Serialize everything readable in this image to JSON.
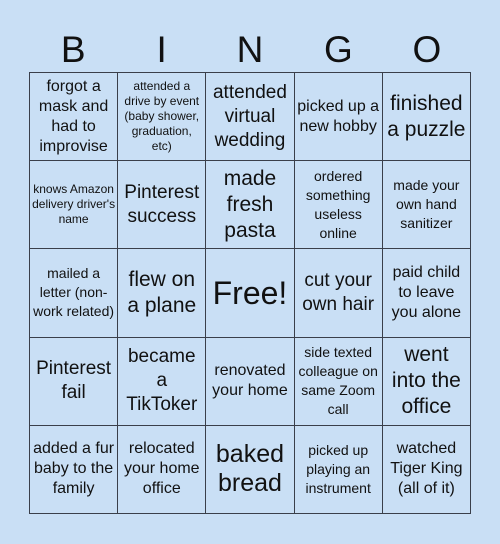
{
  "header": {
    "letters": [
      "B",
      "I",
      "N",
      "G",
      "O"
    ]
  },
  "board": {
    "rows": [
      [
        "forgot a mask and had to improvise",
        "attended a drive by event (baby shower, graduation, etc)",
        "attended virtual wedding",
        "picked up a new hobby",
        "finished a puzzle"
      ],
      [
        "knows Amazon delivery driver's name",
        "Pinterest success",
        "made fresh pasta",
        "ordered something useless online",
        "made your own hand sanitizer"
      ],
      [
        "mailed a letter (non-work related)",
        "flew on a plane",
        "Free!",
        "cut your own hair",
        "paid child to leave you alone"
      ],
      [
        "Pinterest fail",
        "became a TikToker",
        "renovated your home",
        "side texted colleague on same Zoom call",
        "went into the office"
      ],
      [
        "added a fur baby to the family",
        "relocated your home office",
        "baked bread",
        "picked up playing an instrument",
        "watched Tiger King (all of it)"
      ]
    ]
  },
  "colors": {
    "background": "#c9dff5",
    "grid_line": "#3a3f4a",
    "text": "#111111"
  }
}
